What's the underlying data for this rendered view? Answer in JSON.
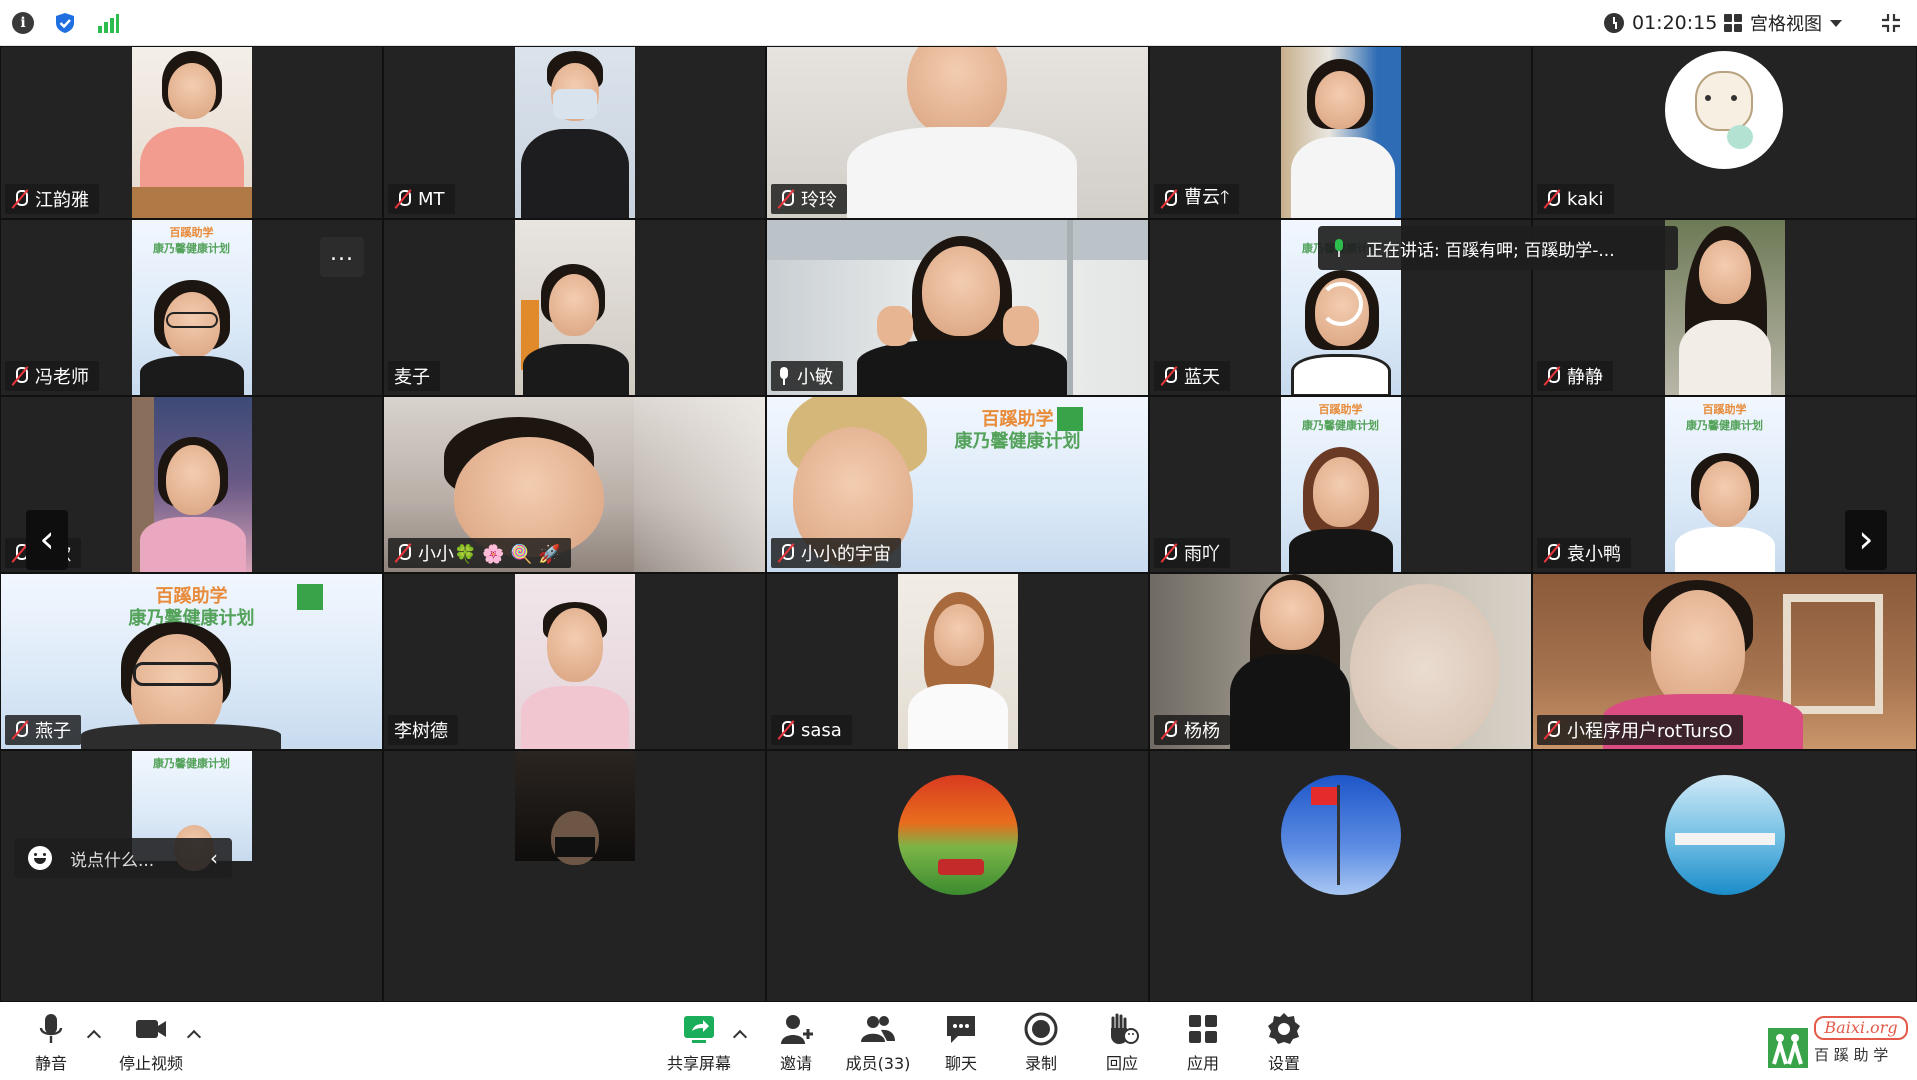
{
  "topbar": {
    "time": "01:20:15",
    "view_mode": "宫格视图"
  },
  "tiles": [
    {
      "name": "江韵雅",
      "mic": "off"
    },
    {
      "name": "MT",
      "mic": "off"
    },
    {
      "name": "玲玲",
      "mic": "off"
    },
    {
      "name": "曹云🡑",
      "mic": "off"
    },
    {
      "name": "kaki",
      "mic": "off"
    },
    {
      "name": "冯老师",
      "mic": "off"
    },
    {
      "name": "麦子",
      "mic": "none"
    },
    {
      "name": "小敏",
      "mic": "on"
    },
    {
      "name": "蓝天",
      "mic": "off"
    },
    {
      "name": "静静",
      "mic": "off"
    },
    {
      "name": "船歌",
      "mic": "off"
    },
    {
      "name": "小小🍀 🌸 🍭 🚀",
      "mic": "off"
    },
    {
      "name": "小小的宇宙",
      "mic": "off"
    },
    {
      "name": "雨吖",
      "mic": "off"
    },
    {
      "name": "袁小鸭",
      "mic": "off"
    },
    {
      "name": "燕子",
      "mic": "off"
    },
    {
      "name": "李树德",
      "mic": "none"
    },
    {
      "name": "sasa",
      "mic": "off"
    },
    {
      "name": "杨杨",
      "mic": "off"
    },
    {
      "name": "小程序用户rotTursO",
      "mic": "off"
    },
    {
      "name": "",
      "mic": "none"
    },
    {
      "name": "",
      "mic": "none"
    },
    {
      "name": "",
      "mic": "none"
    },
    {
      "name": "",
      "mic": "none"
    },
    {
      "name": "",
      "mic": "none"
    }
  ],
  "speaking": {
    "text": "正在讲话:  百蹊有呷; 百蹊助学-..."
  },
  "more_label": "...",
  "chat": {
    "placeholder": "说点什么..."
  },
  "poster": {
    "title1": "百蹊助学",
    "title2": "康乃馨健康计划"
  },
  "toolbar": {
    "mute": "静音",
    "stop_video": "停止视频",
    "share": "共享屏幕",
    "invite": "邀请",
    "members": "成员(33)",
    "chat": "聊天",
    "record": "录制",
    "react": "回应",
    "apps": "应用",
    "settings": "设置"
  },
  "brand": {
    "text1": "Baixi.org",
    "text2": "百 蹊 助 学"
  },
  "colors": {
    "muted_red": "#e8353b",
    "speaking_green": "#2dbd4e",
    "share_green": "#1aad5a",
    "shield_blue": "#1f6fe0",
    "signal_green": "#2dbd4e"
  }
}
